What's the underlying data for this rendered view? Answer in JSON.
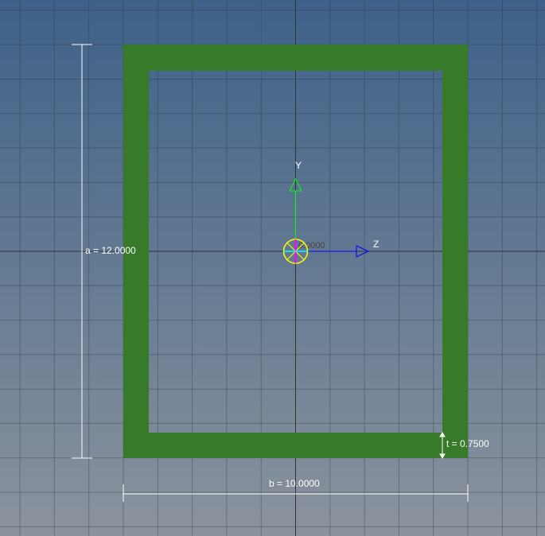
{
  "section": {
    "shape": "rectangular tube",
    "fill_color": "#367a2a"
  },
  "dimensions": {
    "a_label": "a = 12.0000",
    "b_label": "b = 10.0000",
    "t_label": "t = 0.7500"
  },
  "axes": {
    "y_label": "Y",
    "z_label": "Z",
    "origin_label": "0.0000",
    "y_color": "#00ff00",
    "z_color": "#0000ff",
    "origin_color": "#ffff00"
  }
}
